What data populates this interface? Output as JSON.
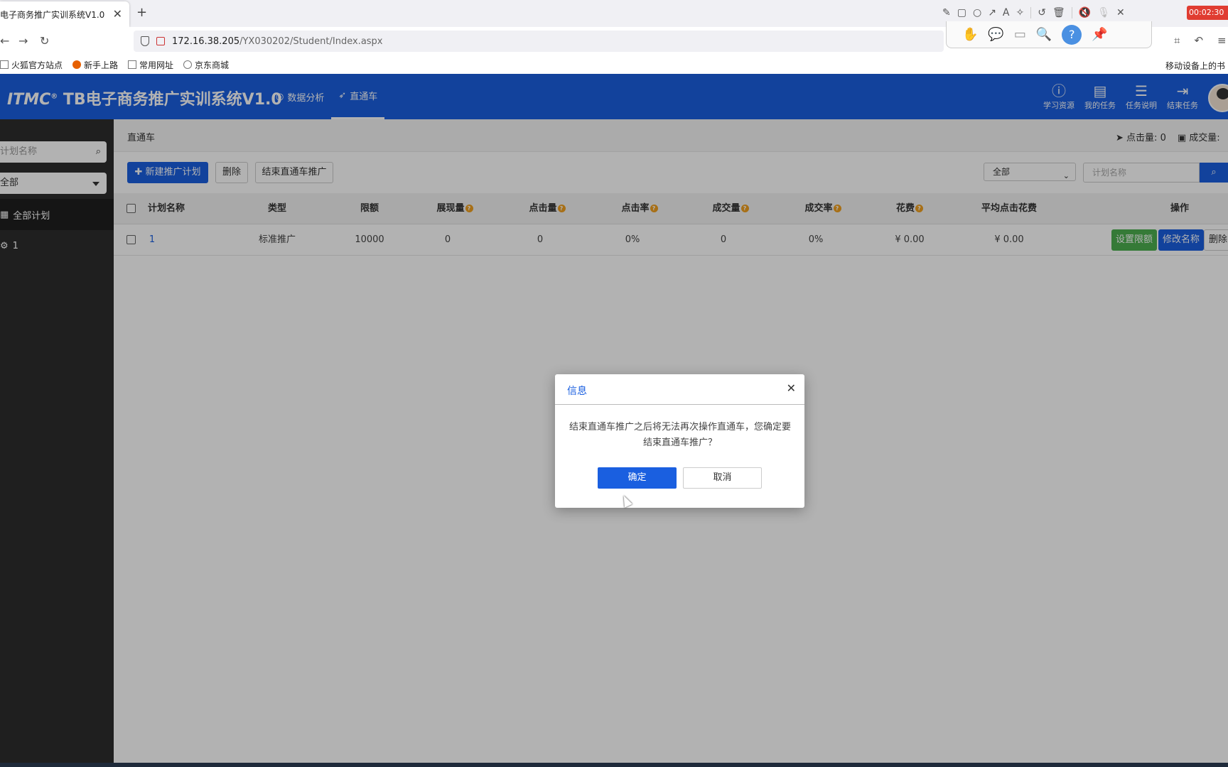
{
  "browser": {
    "tab_title": "电子商务推广实训系统V1.0",
    "tab_close": "✕",
    "new_tab": "+",
    "url_host": "172.16.38.205",
    "url_path": "/YX030202/Student/Index.aspx",
    "bookmarks": [
      "火狐官方站点",
      "新手上路",
      "常用网址",
      "京东商城"
    ],
    "bookmark_right": "移动设备上的书",
    "recording_time": "00:02:30"
  },
  "app": {
    "logo_brand": "ITMC",
    "logo_reg": "®",
    "logo_title": "TB电子商务推广实训系统V1.0",
    "nav": [
      {
        "label": "数据分析",
        "icon": "target-icon"
      },
      {
        "label": "直通车",
        "icon": "rocket-icon"
      }
    ],
    "tools": [
      {
        "label": "学习资源",
        "icon": "question-icon"
      },
      {
        "label": "我的任务",
        "icon": "bookmark-icon"
      },
      {
        "label": "任务说明",
        "icon": "list-icon"
      },
      {
        "label": "结束任务",
        "icon": "logout-icon"
      }
    ]
  },
  "sidebar": {
    "search_placeholder": "计划名称",
    "select_value": "全部",
    "items": [
      {
        "label": "全部计划",
        "icon": "grid-icon"
      },
      {
        "label": "1",
        "icon": "gear-icon"
      }
    ]
  },
  "main": {
    "breadcrumb": "直通车",
    "stats": {
      "clicks_label": "点击量:",
      "clicks_value": "0",
      "deals_label": "成交量:"
    },
    "buttons": {
      "new_plan": "新建推广计划",
      "delete": "删除",
      "end_promo": "结束直通车推广"
    },
    "filter_select": "全部",
    "filter_placeholder": "计划名称",
    "columns": [
      "计划名称",
      "类型",
      "限额",
      "展现量",
      "点击量",
      "点击率",
      "成交量",
      "成交率",
      "花费",
      "平均点击花费",
      "操作"
    ],
    "rows": [
      {
        "name": "1",
        "type": "标准推广",
        "limit": "10000",
        "impressions": "0",
        "clicks": "0",
        "ctr": "0%",
        "deals": "0",
        "deal_rate": "0%",
        "cost": "¥ 0.00",
        "avg_cost": "¥ 0.00"
      }
    ],
    "row_actions": {
      "set_limit": "设置限额",
      "rename": "修改名称",
      "delete": "删除"
    }
  },
  "dialog": {
    "title": "信息",
    "close": "✕",
    "message": "结束直通车推广之后将无法再次操作直通车，您确定要结束直通车推广？",
    "ok": "确定",
    "cancel": "取消"
  },
  "colors": {
    "brand": "#1a5fe0",
    "green": "#4caf50",
    "sidebar": "#2d2d2d",
    "warn": "#f0a020"
  }
}
